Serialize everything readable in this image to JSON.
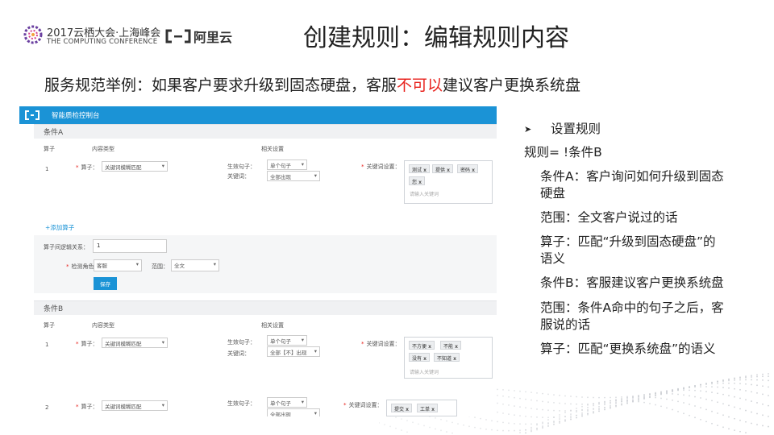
{
  "header": {
    "event_title": "2017云栖大会·上海峰会",
    "event_subtitle": "THE COMPUTING CONFERENCE",
    "company": "阿里云",
    "slide_title": "创建规则：编辑规则内容"
  },
  "subtitle": {
    "prefix": "服务规范举例：如果客户要求升级到固态硬盘，客服",
    "highlight": "不可以",
    "suffix": "建议客户更换系统盘"
  },
  "console": {
    "app_name": "智能质检控制台",
    "condition_a": {
      "section_title": "条件A",
      "col_operator": "算子",
      "col_content_type": "内容类型",
      "col_settings": "相关设置",
      "row_index": "1",
      "operator_label": "算子：",
      "operator_value": "关键词模糊匹配",
      "effective_sentence_label": "生效句子：",
      "effective_sentence_value": "单个句子",
      "keyword_label": "关键词：",
      "keyword_value": "全部出现",
      "keyword_setting_label": "关键词设置：",
      "tags": [
        "测试",
        "提供",
        "密码",
        "您"
      ],
      "tag_placeholder": "请输入关键词",
      "add_operator_link": "+添加算子",
      "logic_label": "算子间逻辑关系：",
      "logic_value": "1",
      "role_label": "检测角色：",
      "role_value": "客服",
      "scope_label": "范围：",
      "scope_value": "全文",
      "save_label": "保存"
    },
    "condition_b": {
      "section_title": "条件B",
      "col_operator": "算子",
      "col_content_type": "内容类型",
      "col_settings": "相关设置",
      "row1_index": "1",
      "row1_operator_label": "算子：",
      "row1_operator_value": "关键词模糊匹配",
      "row1_effective_label": "生效句子：",
      "row1_effective_value": "单个句子",
      "row1_keyword_label": "关键词：",
      "row1_keyword_value": "全部【不】出现",
      "row1_keyword_setting_label": "关键词设置：",
      "row1_tags": [
        "不方便",
        "不能",
        "没有",
        "不知道"
      ],
      "row1_tag_placeholder": "请输入关键词",
      "row2_index": "2",
      "row2_operator_label": "算子：",
      "row2_operator_value": "关键词模糊匹配",
      "row2_effective_label": "生效句子：",
      "row2_effective_value": "单个句子",
      "row2_keyword_value": "全部出现",
      "row2_keyword_setting_label": "关键词设置：",
      "row2_tags": [
        "提交",
        "工单"
      ]
    }
  },
  "notes": {
    "heading": "设置规则",
    "rule": "规则= !条件B",
    "cond_a_1": "条件A：客户询问如何升级到固态",
    "cond_a_2": "硬盘",
    "scope_a": "范围：全文客户说过的话",
    "op_a_1": "算子：匹配“升级到固态硬盘”的",
    "op_a_2": "语义",
    "cond_b": "条件B：客服建议客户更换系统盘",
    "scope_b_1": "范围：条件A命中的句子之后，客",
    "scope_b_2": "服说的话",
    "op_b": "算子：匹配“更换系统盘”的语义"
  },
  "colors": {
    "accent_blue": "#1b93d6",
    "highlight_red": "#e8211c"
  }
}
